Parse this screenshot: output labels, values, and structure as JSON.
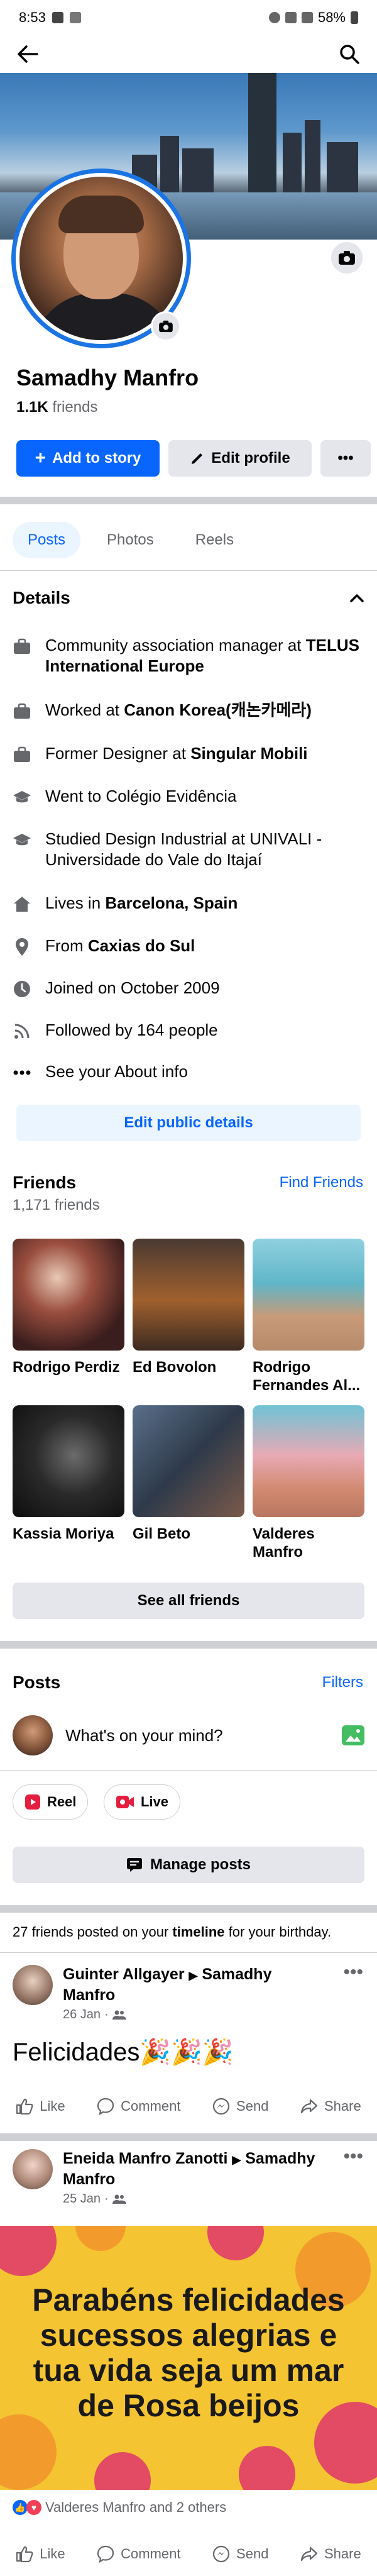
{
  "status_bar": {
    "time": "8:53",
    "battery": "58%"
  },
  "profile": {
    "name": "Samadhy Manfro",
    "friends_count_value": "1.1K",
    "friends_count_label": "friends"
  },
  "actions": {
    "add_story": "Add to story",
    "edit_profile": "Edit profile",
    "more": "•••"
  },
  "tabs": [
    {
      "label": "Posts"
    },
    {
      "label": "Photos"
    },
    {
      "label": "Reels"
    }
  ],
  "details": {
    "title": "Details",
    "items": [
      {
        "icon": "briefcase-icon",
        "prefix": "Community association manager at",
        "bold": "TELUS International Europe"
      },
      {
        "icon": "briefcase-icon",
        "prefix": "Worked at",
        "bold": "Canon Korea(캐논카메라)"
      },
      {
        "icon": "briefcase-icon",
        "prefix": "Former Designer at",
        "bold": "Singular Mobili"
      },
      {
        "icon": "graduation-cap-icon",
        "prefix": "Went to Colégio Evidência",
        "bold": ""
      },
      {
        "icon": "graduation-cap-icon",
        "prefix": "Studied Design Industrial at UNIVALI - Universidade do Vale do Itajaí",
        "bold": ""
      },
      {
        "icon": "home-icon",
        "prefix": "Lives in",
        "bold": "Barcelona, Spain"
      },
      {
        "icon": "location-pin-icon",
        "prefix": "From",
        "bold": "Caxias do Sul"
      },
      {
        "icon": "clock-icon",
        "prefix": "Joined on October 2009",
        "bold": ""
      },
      {
        "icon": "rss-icon",
        "prefix": "Followed by 164 people",
        "bold": ""
      },
      {
        "icon": "ellipsis-icon",
        "prefix": "See your About info",
        "bold": ""
      }
    ],
    "edit_public": "Edit public details"
  },
  "friends": {
    "title": "Friends",
    "count": "1,171 friends",
    "find": "Find Friends",
    "list": [
      {
        "name": "Rodrigo Perdiz"
      },
      {
        "name": "Ed Bovolon"
      },
      {
        "name": "Rodrigo Fernandes Al..."
      },
      {
        "name": "Kassia Moriya"
      },
      {
        "name": "Gil Beto"
      },
      {
        "name": "Valderes Manfro"
      }
    ],
    "see_all": "See all friends"
  },
  "posts_section": {
    "title": "Posts",
    "filters": "Filters",
    "composer_placeholder": "What's on your mind?",
    "reel": "Reel",
    "live": "Live",
    "manage": "Manage posts"
  },
  "birthday_note": {
    "pre": "27 friends posted on your",
    "bold": "timeline",
    "post": "for your birthday."
  },
  "post1": {
    "author": "Guinter Allgayer",
    "target": "Samadhy Manfro",
    "date": "26 Jan",
    "text": "Felicidades🎉🎉🎉"
  },
  "post2": {
    "author": "Eneida Manfro Zanotti",
    "target": "Samadhy Manfro",
    "date": "25 Jan",
    "image_text": "Parabéns felicidades sucessos alegrias e tua vida seja um mar de Rosa beijos",
    "reactions_text": "Valderes Manfro and 2 others"
  },
  "post_actions": {
    "like": "Like",
    "comment": "Comment",
    "send": "Send",
    "share": "Share"
  },
  "colors": {
    "accent": "#0866ff",
    "separator": "#ced0d4",
    "button_grey": "#e4e6eb"
  }
}
